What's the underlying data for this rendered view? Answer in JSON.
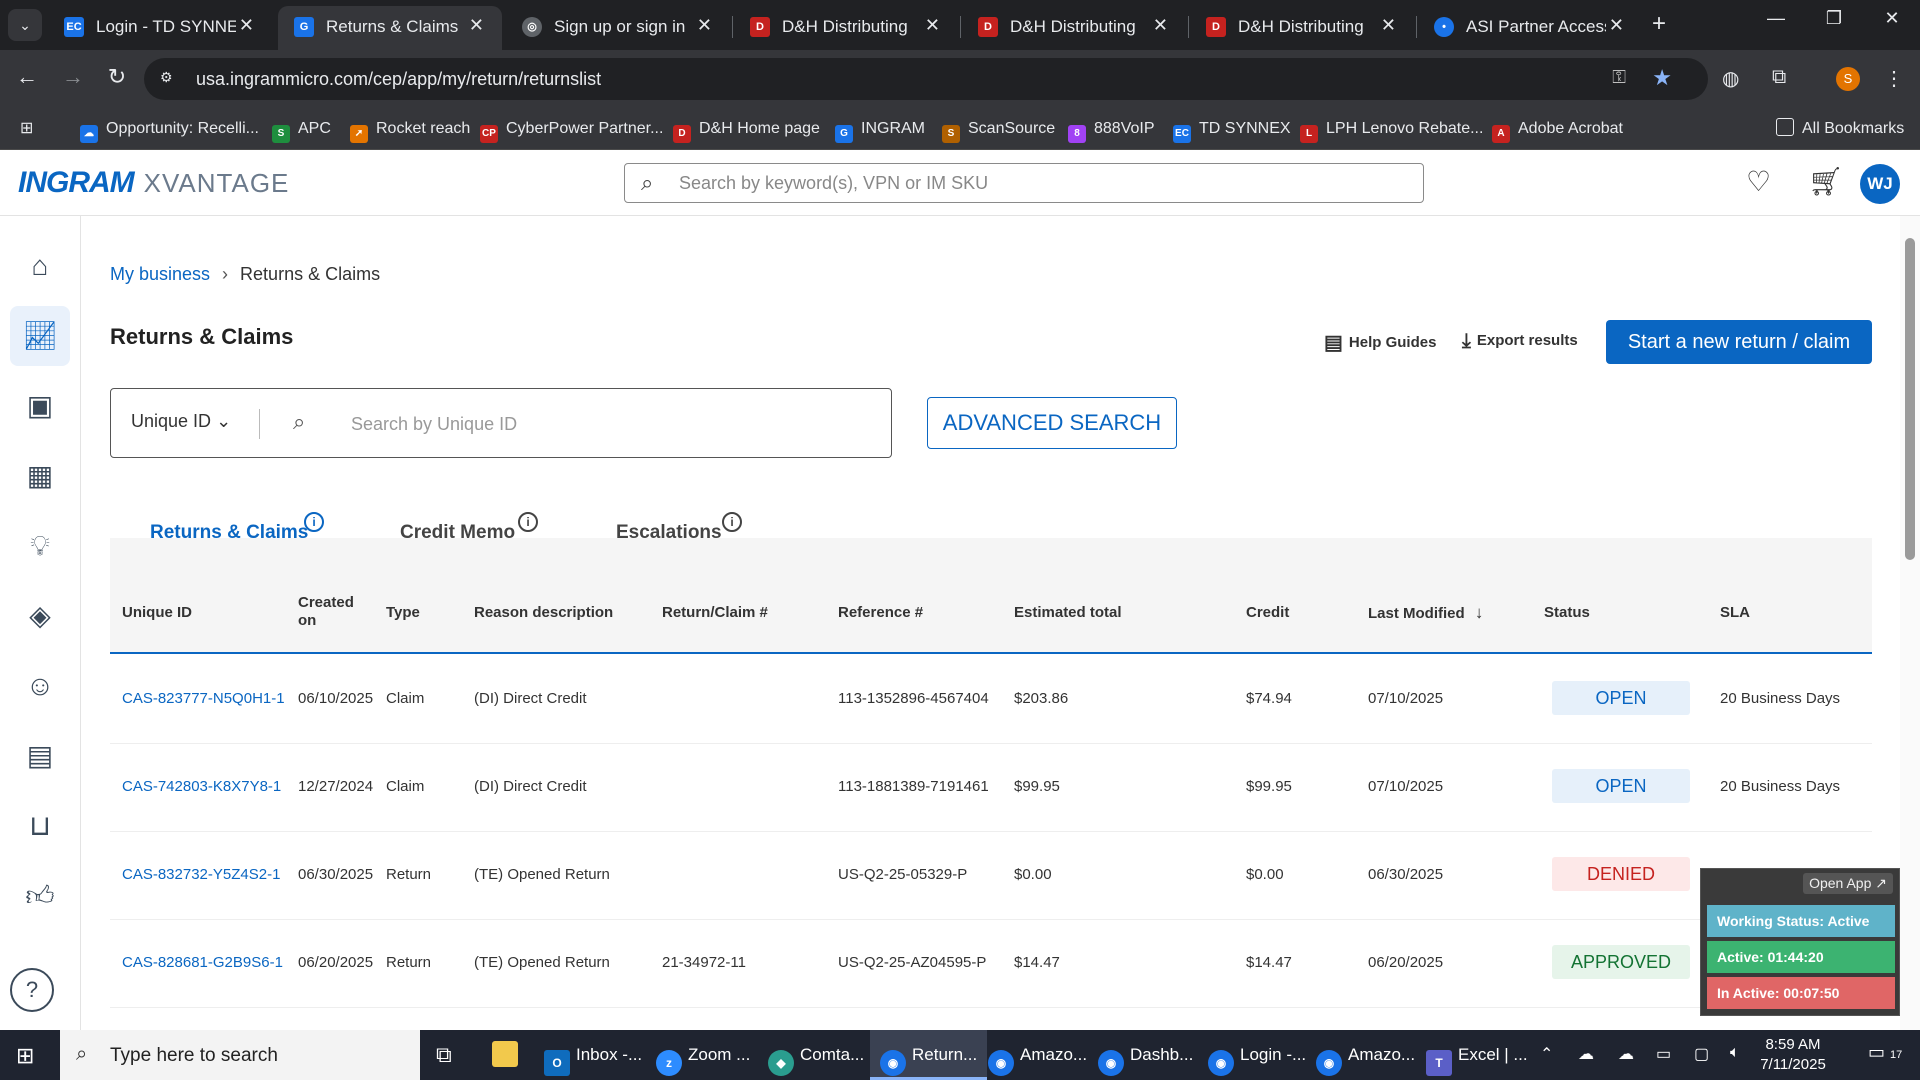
{
  "browser": {
    "tabs": [
      {
        "title": "Login - TD SYNNEX",
        "icon": "ec-favicon",
        "color": "#1a73e8"
      },
      {
        "title": "Returns & Claims",
        "icon": "ingram-favicon",
        "color": "#1a73e8"
      },
      {
        "title": "Sign up or sign in",
        "icon": "globe-favicon",
        "color": "#5f6368"
      },
      {
        "title": "D&H Distributing",
        "icon": "dh-favicon",
        "color": "#c5221f"
      },
      {
        "title": "D&H Distributing",
        "icon": "dh-favicon",
        "color": "#c5221f"
      },
      {
        "title": "D&H Distributing",
        "icon": "dh-favicon",
        "color": "#c5221f"
      },
      {
        "title": "ASI Partner Access",
        "icon": "asi-favicon",
        "color": "#1a73e8"
      }
    ],
    "url": "usa.ingrammicro.com/cep/app/my/return/returnslist",
    "bookmarks": [
      {
        "label": "Opportunity: Recelli...",
        "color": "#1a73e8"
      },
      {
        "label": "APC",
        "color": "#1e8e3e"
      },
      {
        "label": "Rocket reach",
        "color": "#e37400"
      },
      {
        "label": "CyberPower Partner...",
        "color": "#c5221f"
      },
      {
        "label": "D&H Home page",
        "color": "#c5221f"
      },
      {
        "label": "INGRAM",
        "color": "#1a73e8"
      },
      {
        "label": "ScanSource",
        "color": "#b06000"
      },
      {
        "label": "888VoIP",
        "color": "#a142f4"
      },
      {
        "label": "TD SYNNEX",
        "color": "#1a73e8"
      },
      {
        "label": "LPH Lenovo Rebate...",
        "color": "#c5221f"
      },
      {
        "label": "Adobe Acrobat",
        "color": "#c5221f"
      }
    ],
    "all_bookmarks": "All Bookmarks"
  },
  "header": {
    "logo_main": "INGRAM",
    "logo_sub": "XVANTAGE",
    "search_placeholder": "Search by keyword(s), VPN or IM SKU",
    "avatar": "WJ"
  },
  "page": {
    "breadcrumb_root": "My business",
    "breadcrumb_current": "Returns & Claims",
    "title": "Returns & Claims",
    "help_guides": "Help Guides",
    "export_results": "Export results",
    "start_new": "Start a new return / claim",
    "filter_select": "Unique ID",
    "filter_placeholder": "Search by Unique ID",
    "advanced_search": "ADVANCED SEARCH",
    "tabs": [
      "Returns & Claims",
      "Credit Memo",
      "Escalations"
    ]
  },
  "table": {
    "columns": [
      "Unique ID",
      "Created on",
      "Type",
      "Reason description",
      "Return/Claim #",
      "Reference #",
      "Estimated total",
      "Credit",
      "Last Modified",
      "Status",
      "SLA"
    ],
    "rows": [
      {
        "id": "CAS-823777-N5Q0H1-1",
        "created": "06/10/2025",
        "type": "Claim",
        "reason": "(DI) Direct Credit",
        "claim_no": "",
        "ref": "113-1352896-4567404",
        "est": "$203.86",
        "credit": "$74.94",
        "modified": "07/10/2025",
        "status": "OPEN",
        "sla": "20 Business Days"
      },
      {
        "id": "CAS-742803-K8X7Y8-1",
        "created": "12/27/2024",
        "type": "Claim",
        "reason": "(DI) Direct Credit",
        "claim_no": "",
        "ref": "113-1881389-7191461",
        "est": "$99.95",
        "credit": "$99.95",
        "modified": "07/10/2025",
        "status": "OPEN",
        "sla": "20 Business Days"
      },
      {
        "id": "CAS-832732-Y5Z4S2-1",
        "created": "06/30/2025",
        "type": "Return",
        "reason": "(TE) Opened Return",
        "claim_no": "",
        "ref": "US-Q2-25-05329-P",
        "est": "$0.00",
        "credit": "$0.00",
        "modified": "06/30/2025",
        "status": "DENIED",
        "sla": ""
      },
      {
        "id": "CAS-828681-G2B9S6-1",
        "created": "06/20/2025",
        "type": "Return",
        "reason": "(TE) Opened Return",
        "claim_no": "21-34972-11",
        "ref": "US-Q2-25-AZ04595-P",
        "est": "$14.47",
        "credit": "$14.47",
        "modified": "06/20/2025",
        "status": "APPROVED",
        "sla": ""
      }
    ],
    "status_colors": {
      "OPEN": {
        "bg": "#e6f0fa",
        "fg": "#0a66c2"
      },
      "DENIED": {
        "bg": "#fde8e8",
        "fg": "#c5221f"
      },
      "APPROVED": {
        "bg": "#e6f4ea",
        "fg": "#137333"
      }
    }
  },
  "widget": {
    "open_app": "Open App ↗",
    "working_status": "Working Status: Active",
    "active": "Active: 01:44:20",
    "inactive": "In Active: 00:07:50"
  },
  "taskbar": {
    "search_text": "Type here to search",
    "apps": [
      {
        "label": "Inbox -...",
        "color": "#0f6cbd"
      },
      {
        "label": "Zoom ...",
        "color": "#2d8cff"
      },
      {
        "label": "Comta...",
        "color": "#2a9d8f"
      },
      {
        "label": "Return...",
        "color": "#1a73e8"
      },
      {
        "label": "Amazo...",
        "color": "#1a73e8"
      },
      {
        "label": "Dashb...",
        "color": "#1a73e8"
      },
      {
        "label": "Login -...",
        "color": "#1a73e8"
      },
      {
        "label": "Amazo...",
        "color": "#1a73e8"
      },
      {
        "label": "Excel | ...",
        "color": "#5b5fc7"
      }
    ],
    "time": "8:59 AM",
    "date": "7/11/2025",
    "notifications": "17"
  }
}
